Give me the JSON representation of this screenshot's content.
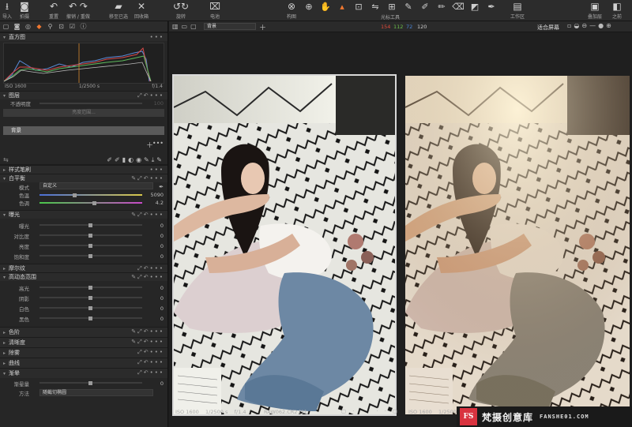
{
  "toolbar": {
    "import": "导入",
    "capture": "拍摄",
    "reset": "重置",
    "undo_redo": "撤销 / 重做",
    "move_selected": "移至已选",
    "trash": "回收箱",
    "rotate": "旋转",
    "battery": "电池",
    "compose": "构图",
    "cursor_tools": "光标工具",
    "workspace": "工作区",
    "overlay": "叠加层",
    "before": "之前"
  },
  "histogram": {
    "title": "直方图",
    "iso": "ISO 1600",
    "shutter": "1/2500 s",
    "aperture": "f/1.4"
  },
  "layers": {
    "title": "图层",
    "opacity_label": "不透明度",
    "opacity_value": "100",
    "brightness_range": "亮度范围...",
    "selected_layer": "背景"
  },
  "sections": {
    "style_brush": "样式笔刷",
    "white_balance": "白平衡",
    "exposure": "曝光",
    "moire": "摩尔纹",
    "hdr": "高动态范围",
    "levels": "色阶",
    "clarity": "清晰度",
    "dehaze": "除雾",
    "curve": "曲线",
    "vignette": "渐晕"
  },
  "white_balance": {
    "mode_label": "模式",
    "mode_value": "自定义",
    "temp_label": "色温",
    "temp_value": "5090",
    "tint_label": "色调",
    "tint_value": "4.2"
  },
  "exposure": {
    "rows": [
      {
        "label": "曝光",
        "value": "0"
      },
      {
        "label": "对比度",
        "value": "0"
      },
      {
        "label": "亮度",
        "value": "0"
      },
      {
        "label": "饱和度",
        "value": "0"
      }
    ]
  },
  "hdr": {
    "rows": [
      {
        "label": "高光",
        "value": "0"
      },
      {
        "label": "阴影",
        "value": "0"
      },
      {
        "label": "白色",
        "value": "0"
      },
      {
        "label": "黑色",
        "value": "0"
      }
    ]
  },
  "vignette": {
    "amount_label": "渐晕量",
    "amount_value": "0",
    "method_label": "方法",
    "method_value": "随截切椭圆"
  },
  "viewer": {
    "layer_dropdown": "背景",
    "rgb_r": "154",
    "rgb_g": "112",
    "rgb_b": "72",
    "rgb_a": "120",
    "fit": "适合屏幕",
    "left_iso": "ISO 1600",
    "left_shutter": "1/2500 s",
    "left_aperture": "f/1.4",
    "left_filename": "RAW062.CR2 [1]",
    "right_iso": "ISO 1600",
    "right_shutter": "1/2500 s"
  },
  "watermark": {
    "logo": "FS",
    "name": "梵摄创意库",
    "domain": "FANSHE01.COM"
  },
  "colors": {
    "accent": "#f07830",
    "rgb_r": "#e04a3a",
    "rgb_g": "#6cc04a",
    "rgb_b": "#4a86d8",
    "watermark": "#d9333f"
  }
}
